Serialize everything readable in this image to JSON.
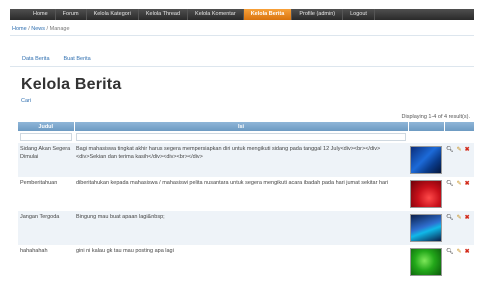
{
  "nav": {
    "items": [
      "Home",
      "Forum",
      "Kelola Kategori",
      "Kelola Thread",
      "Kelola Komentar",
      "Kelola Berita",
      "Profile (admin)",
      "Logout"
    ],
    "active_index": 5
  },
  "breadcrumb": {
    "home": "Home",
    "sep1": " / ",
    "news": "News",
    "sep2": " / ",
    "current": "Manage"
  },
  "tabs": {
    "data_berita": "Data Berita",
    "buat_berita": "Buat Berita"
  },
  "page": {
    "title": "Kelola Berita",
    "search_link": "Cari",
    "summary": "Displaying 1-4 of 4 result(s)."
  },
  "table": {
    "headers": {
      "judul": "Judul",
      "isi": "Isi"
    },
    "rows": [
      {
        "judul": "Sidang Akan Segera Dimulai",
        "isi": "Bagi mahasiswa tingkat akhir harus segera mempersiapkan diri untuk mengikuti sidang pada tanggal 12 July<div><br></div><div>Sekian dan terima kasih</div><div><br></div>",
        "thumb": "blue-abstract-image"
      },
      {
        "judul": "Pemberitahuan",
        "isi": "diberitahukan kepada mahasiswa / mahasiswi pelita nusantara untuk segera mengikuti acara ibadah pada hari jumat sekitar hari",
        "thumb": "red-abstract-image"
      },
      {
        "judul": "Jangan Tergoda",
        "isi": "Bingung mau buat apaan lagi&nbsp;",
        "thumb": "blue-light-image"
      },
      {
        "judul": "hahahahah",
        "isi": "gini ni kalau gk tau mau posting apa lagi",
        "thumb": "green-orb-image"
      }
    ]
  },
  "icons": {
    "view": "magnifier-icon",
    "edit": "pencil-icon",
    "delete": "cross-icon"
  },
  "colors": {
    "nav_bg": "#333333",
    "nav_active": "#e8861f",
    "header_blue": "#7aa5cc",
    "row_alt": "#eef3f8",
    "link": "#2f6fb0"
  }
}
